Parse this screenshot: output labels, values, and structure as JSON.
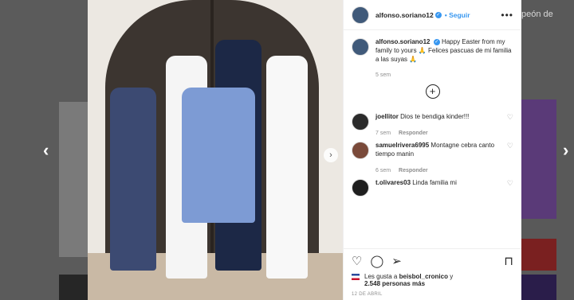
{
  "background": {
    "right_text": "peón de"
  },
  "post": {
    "username": "alfonso.soriano12",
    "follow_label": "Seguir",
    "more_label": "•••",
    "caption": "Happy Easter from my family to yours 🙏 Felices pascuas de mi familia a las suyas 🙏",
    "caption_time": "5 sem",
    "load_more_label": "+"
  },
  "comments": [
    {
      "username": "joellitor",
      "text": "Dios te bendiga kinder!!!",
      "time": "7 sem",
      "reply_label": "Responder"
    },
    {
      "username": "samuelrivera6995",
      "text": "Montagne cebra canto tiempo manin",
      "time": "6 sem",
      "reply_label": "Responder"
    },
    {
      "username": "t.olivares03",
      "text": "Linda familia mi",
      "time": "",
      "reply_label": ""
    }
  ],
  "likes": {
    "prefix": "Les gusta a",
    "user": "beisbol_cronico",
    "connector": "y",
    "count": "2.548 personas más"
  },
  "date": "12 DE ABRIL",
  "icons": {
    "like": "heart-icon",
    "comment": "comment-icon",
    "share": "share-icon",
    "save": "bookmark-icon",
    "prev": "chevron-left-icon",
    "next": "chevron-right-icon"
  },
  "colors": {
    "link": "#3897f0",
    "text": "#262626",
    "muted": "#8e8e8e"
  }
}
